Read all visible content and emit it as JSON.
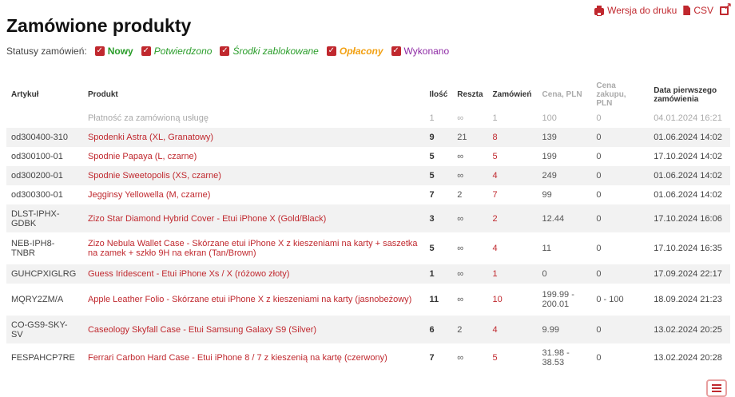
{
  "toplinks": {
    "print_label": "Wersja do druku",
    "csv_label": "CSV"
  },
  "page_title": "Zamówione produkty",
  "statuses": {
    "label": "Statusy zamówień:",
    "items": [
      "Nowy",
      "Potwierdzono",
      "Środki zablokowane",
      "Opłacony",
      "Wykonano"
    ]
  },
  "table": {
    "headers": {
      "artykul": "Artykuł",
      "produkt": "Produkt",
      "ilosc": "Ilość",
      "reszta": "Reszta",
      "zamowien": "Zamówień",
      "cena": "Cena, PLN",
      "cena_zakupu": "Cena zakupu, PLN",
      "data": "Data pierwszego zamówienia"
    },
    "rows": [
      {
        "artykul": "",
        "produkt": "Płatność za zamówioną usługę",
        "ilosc": "1",
        "reszta": "∞",
        "zamowien": "1",
        "cena": "100",
        "zakup": "0",
        "data": "04.01.2024 16:21"
      },
      {
        "artykul": "od300400-310",
        "produkt": "Spodenki Astra (XL, Granatowy)",
        "ilosc": "9",
        "reszta": "21",
        "zamowien": "8",
        "cena": "139",
        "zakup": "0",
        "data": "01.06.2024 14:02"
      },
      {
        "artykul": "od300100-01",
        "produkt": "Spodnie Papaya (L, czarne)",
        "ilosc": "5",
        "reszta": "∞",
        "zamowien": "5",
        "cena": "199",
        "zakup": "0",
        "data": "17.10.2024 14:02"
      },
      {
        "artykul": "od300200-01",
        "produkt": "Spodnie Sweetopolis (XS, czarne)",
        "ilosc": "5",
        "reszta": "∞",
        "zamowien": "4",
        "cena": "249",
        "zakup": "0",
        "data": "01.06.2024 14:02"
      },
      {
        "artykul": "od300300-01",
        "produkt": "Jegginsy Yellowella (M, czarne)",
        "ilosc": "7",
        "reszta": "2",
        "zamowien": "7",
        "cena": "99",
        "zakup": "0",
        "data": "01.06.2024 14:02"
      },
      {
        "artykul": "DLST-IPHX-GDBK",
        "produkt": "Zizo Star Diamond Hybrid Cover - Etui iPhone X (Gold/Black)",
        "ilosc": "3",
        "reszta": "∞",
        "zamowien": "2",
        "cena": "12.44",
        "zakup": "0",
        "data": "17.10.2024 16:06"
      },
      {
        "artykul": "NEB-IPH8-TNBR",
        "produkt": "Zizo Nebula Wallet Case - Skórzane etui iPhone X z kieszeniami na karty + saszetka na zamek + szkło 9H na ekran (Tan/Brown)",
        "ilosc": "5",
        "reszta": "∞",
        "zamowien": "4",
        "cena": "11",
        "zakup": "0",
        "data": "17.10.2024 16:35"
      },
      {
        "artykul": "GUHCPXIGLRG",
        "produkt": "Guess Iridescent - Etui iPhone Xs / X (różowo złoty)",
        "ilosc": "1",
        "reszta": "∞",
        "zamowien": "1",
        "cena": "0",
        "zakup": "0",
        "data": "17.09.2024 22:17"
      },
      {
        "artykul": "MQRY2ZM/A",
        "produkt": "Apple Leather Folio - Skórzane etui iPhone X z kieszeniami na karty (jasnobeżowy)",
        "ilosc": "11",
        "reszta": "∞",
        "zamowien": "10",
        "cena": "199.99 - 200.01",
        "zakup": "0 - 100",
        "data": "18.09.2024 21:23"
      },
      {
        "artykul": "CO-GS9-SKY-SV",
        "produkt": "Caseology Skyfall Case - Etui Samsung Galaxy S9 (Silver)",
        "ilosc": "6",
        "reszta": "2",
        "zamowien": "4",
        "cena": "9.99",
        "zakup": "0",
        "data": "13.02.2024 20:25"
      },
      {
        "artykul": "FESPAHCP7RE",
        "produkt": "Ferrari Carbon Hard Case - Etui iPhone 8 / 7 z kieszenią na kartę (czerwony)",
        "ilosc": "7",
        "reszta": "∞",
        "zamowien": "5",
        "cena": "31.98 - 38.53",
        "zakup": "0",
        "data": "13.02.2024 20:28"
      }
    ]
  },
  "colors": {
    "accent": "#c0282e",
    "status_green": "#2a9d2a",
    "status_orange": "#f2a012",
    "status_purple": "#8e2aa5",
    "zebra": "#f2f2f2"
  }
}
